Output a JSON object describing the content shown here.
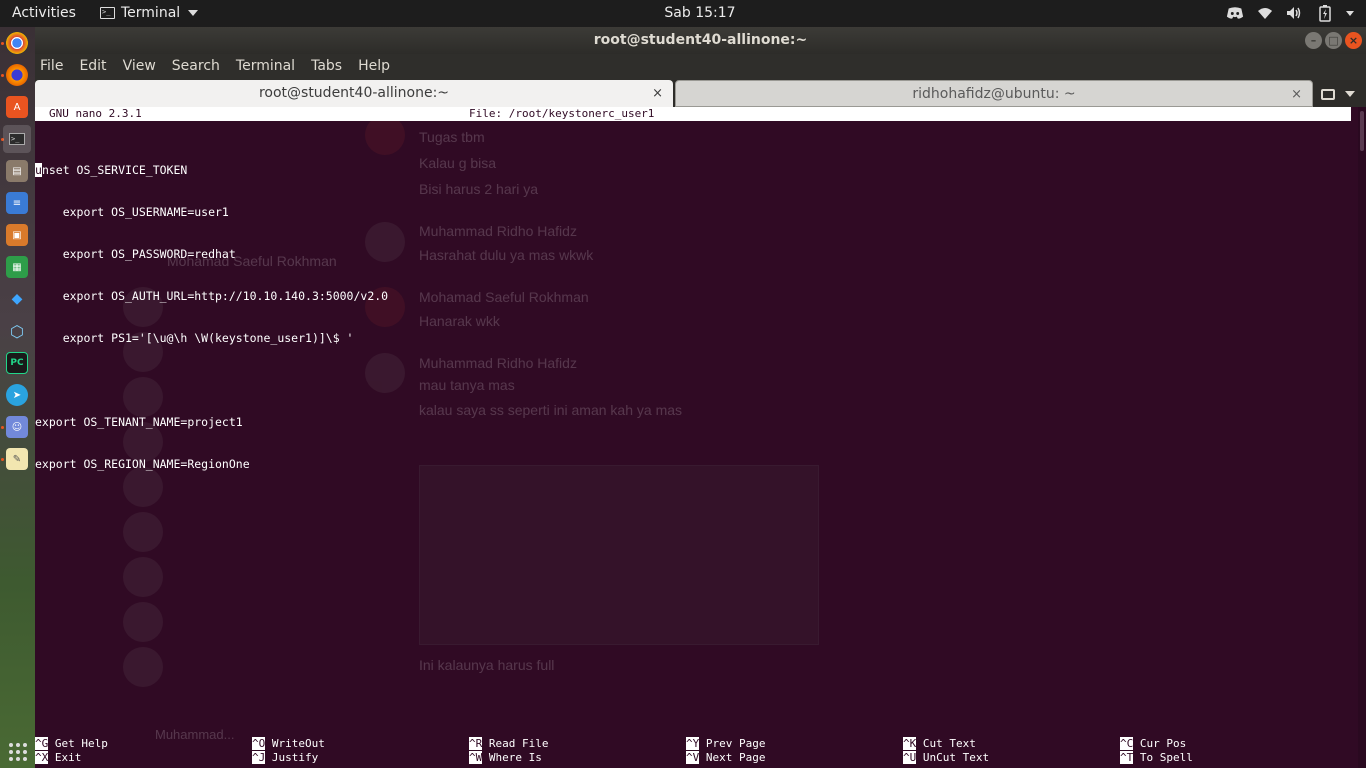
{
  "topbar": {
    "activities": "Activities",
    "app_name": "Terminal",
    "clock": "Sab 15:17",
    "tray_icons": [
      "discord-icon",
      "wifi-icon",
      "volume-icon",
      "battery-icon",
      "system-menu-caret"
    ]
  },
  "dock": {
    "items": [
      {
        "icon": "chrome-icon",
        "running": true
      },
      {
        "icon": "firefox-icon",
        "running": true
      },
      {
        "icon": "ubuntu-software-icon",
        "running": false
      },
      {
        "icon": "terminal-icon",
        "running": true,
        "active": true
      },
      {
        "icon": "files-icon",
        "running": false
      },
      {
        "icon": "text-document-icon",
        "running": false
      },
      {
        "icon": "impress-icon",
        "running": false
      },
      {
        "icon": "calc-icon",
        "running": false
      },
      {
        "icon": "vscode-icon",
        "running": false
      },
      {
        "icon": "virtualbox-icon",
        "running": false
      },
      {
        "icon": "pycharm-icon",
        "running": false
      },
      {
        "icon": "telegram-icon",
        "running": false
      },
      {
        "icon": "discord-icon",
        "running": true
      },
      {
        "icon": "text-editor-icon",
        "running": true
      }
    ],
    "show_apps_icon": "show-applications-icon"
  },
  "window": {
    "title": "root@student40-allinone:~",
    "controls": {
      "minimize": "–",
      "maximize": "□",
      "close": "×"
    },
    "menu": [
      "File",
      "Edit",
      "View",
      "Search",
      "Terminal",
      "Tabs",
      "Help"
    ],
    "tabs": [
      {
        "label": "root@student40-allinone:~",
        "close": "×",
        "active": true
      },
      {
        "label": "ridhohafidz@ubuntu: ~",
        "close": "×",
        "active": false
      }
    ]
  },
  "nano": {
    "version": "GNU nano 2.3.1",
    "file": "File: /root/keystonerc_user1",
    "cursor_char": "u",
    "first_line_rest": "nset OS_SERVICE_TOKEN",
    "lines": [
      "    export OS_USERNAME=user1",
      "    export OS_PASSWORD=redhat",
      "    export OS_AUTH_URL=http://10.10.140.3:5000/v2.0",
      "    export PS1='[\\u@\\h \\W(keystone_user1)]\\$ '",
      "",
      "export OS_TENANT_NAME=project1",
      "export OS_REGION_NAME=RegionOne"
    ],
    "shortcuts": [
      {
        "key": "^G",
        "label": " Get Help"
      },
      {
        "key": "^O",
        "label": " WriteOut"
      },
      {
        "key": "^R",
        "label": " Read File"
      },
      {
        "key": "^Y",
        "label": " Prev Page"
      },
      {
        "key": "^K",
        "label": " Cut Text"
      },
      {
        "key": "^C",
        "label": " Cur Pos"
      },
      {
        "key": "^X",
        "label": " Exit"
      },
      {
        "key": "^J",
        "label": " Justify"
      },
      {
        "key": "^W",
        "label": " Where Is"
      },
      {
        "key": "^V",
        "label": " Next Page"
      },
      {
        "key": "^U",
        "label": " UnCut Text"
      },
      {
        "key": "^T",
        "label": " To Spell"
      }
    ]
  },
  "background_ghost": {
    "texts": [
      "Tugas tbm",
      "Kalau g bisa",
      "Bisi harus 2 hari ya",
      "Muhammad Ridho Hafidz",
      "Hasrahat dulu ya mas wkwk",
      "Mohamad Saeful Rokhman",
      "Mohamad Saeful Rokhman",
      "Hanarak wkk",
      "Muhammad Ridho Hafidz",
      "mau tanya mas",
      "kalau saya ss seperti ini aman kah ya mas",
      "Ini kalaunya harus full",
      "Muhammad..."
    ]
  }
}
